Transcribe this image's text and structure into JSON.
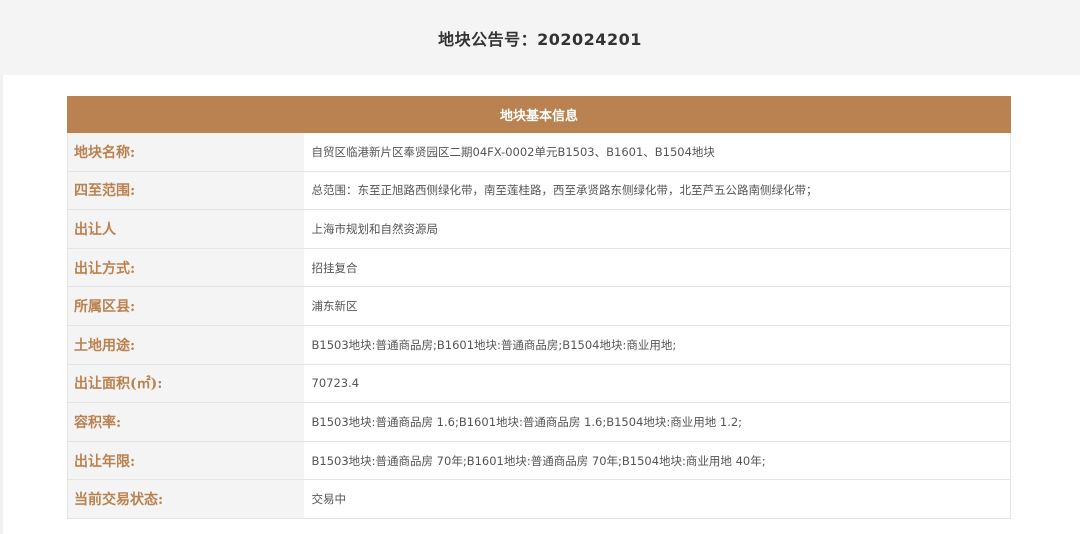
{
  "header": {
    "title": "地块公告号：202024201"
  },
  "table": {
    "heading": "地块基本信息",
    "rows": [
      {
        "label": "地块名称:",
        "value": "自贸区临港新片区奉贤园区二期04FX-0002单元B1503、B1601、B1504地块"
      },
      {
        "label": "四至范围:",
        "value": "总范围：东至正旭路西侧绿化带，南至莲桂路，西至承贤路东侧绿化带，北至芦五公路南侧绿化带；"
      },
      {
        "label": "出让人",
        "value": "上海市规划和自然资源局"
      },
      {
        "label": "出让方式:",
        "value": "招挂复合"
      },
      {
        "label": "所属区县:",
        "value": "浦东新区"
      },
      {
        "label": "土地用途:",
        "value": "B1503地块:普通商品房;B1601地块:普通商品房;B1504地块:商业用地;"
      },
      {
        "label": "出让面积(㎡):",
        "value": "70723.4"
      },
      {
        "label": "容积率:",
        "value": "B1503地块:普通商品房 1.6;B1601地块:普通商品房 1.6;B1504地块:商业用地 1.2;"
      },
      {
        "label": "出让年限:",
        "value": "B1503地块:普通商品房 70年;B1601地块:普通商品房 70年;B1504地块:商业用地 40年;"
      },
      {
        "label": "当前交易状态:",
        "value": "交易中"
      }
    ]
  },
  "colors": {
    "accent": "#b98250",
    "label_bg": "#f4f4f4",
    "header_bg": "#f4f4f4"
  }
}
